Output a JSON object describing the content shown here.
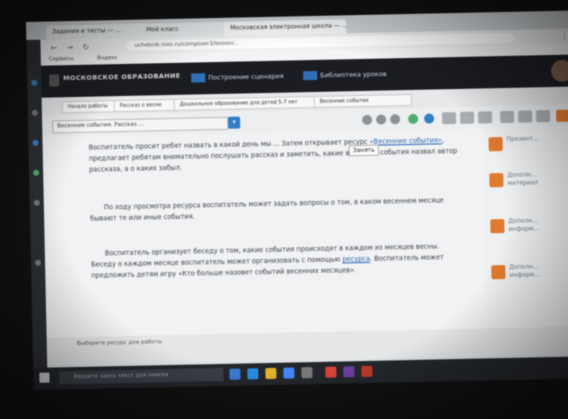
{
  "browser": {
    "tabs": [
      {
        "label": "Задания и тесты — ..."
      },
      {
        "label": "Мой класс"
      },
      {
        "label": "Московская электронная школа — ..."
      }
    ],
    "url": "uchebnik.mos.ru/composer3/lesson/...",
    "bookmarks": [
      "Сервисы",
      "Яндекс"
    ]
  },
  "site": {
    "logo": "МОСКОВСКОЕ ОБРАЗОВАНИЕ",
    "nav": [
      {
        "label": "Построение сценария",
        "icon": "layout-icon"
      },
      {
        "label": "Библиотека уроков",
        "icon": "library-icon"
      }
    ]
  },
  "breadcrumbs": [
    "Начало работы",
    "Рассказ о весне",
    "Дошкольное образование для детей 5-7 лет",
    "Весенние события"
  ],
  "toolbar": {
    "select_value": "Весенние события. Рассказ ...",
    "select_button": "▾",
    "tooltip": "Занять"
  },
  "content": {
    "p1_a": "Воспитатель просит ребят назвать в какой день мы ... Затем открывает ресурс ",
    "p1_link": "«Весенние события»",
    "p1_b": ", предлагает ребятам внимательно послушать рассказ и заметить, какие весенние события назвал автор рассказа, а о каких забыл.",
    "p2": "По ходу просмотра ресурса воспитатель может задать вопросы о том, в каком весеннем месяце бывают те или иные события.",
    "p3_a": "Воспитатель организует беседу о том, какие события происходят в каждом из месяцев весны. Беседу о каждом месяце воспитатель может организовать с помощью ",
    "p3_link": "ресурса",
    "p3_b": ". Воспитатель может предложить детям игру «Кто больше назовет событий весенних месяцев»."
  },
  "sidebar": {
    "items": [
      {
        "label": "Презент..."
      },
      {
        "label": "Дополн...\nматериал"
      },
      {
        "label": "Дополн...\nинформ..."
      },
      {
        "label": "Дополн...\nинформ..."
      }
    ]
  },
  "footer": {
    "label": "Выберите ресурс для работы"
  },
  "taskbar": {
    "search_placeholder": "Введите здесь текст для поиска",
    "tray": "RU"
  }
}
